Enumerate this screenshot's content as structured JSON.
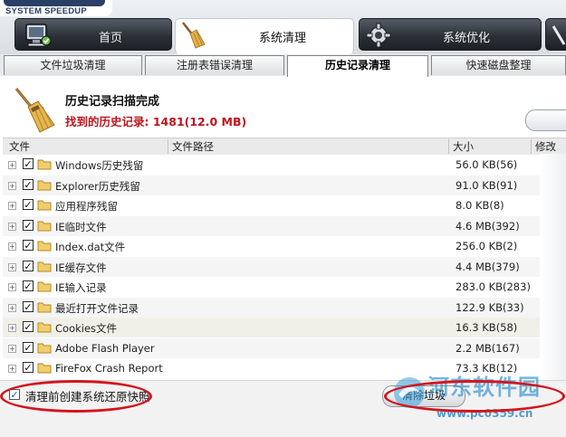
{
  "app": {
    "logo_text": "SYSTEM SPEEDUP"
  },
  "main_tabs": [
    {
      "label": "首页",
      "icon": "home-pc-icon"
    },
    {
      "label": "系统清理",
      "icon": "broom-icon"
    },
    {
      "label": "系统优化",
      "icon": "gear-icon"
    }
  ],
  "sub_tabs": [
    {
      "label": "文件垃圾清理"
    },
    {
      "label": "注册表错误清理"
    },
    {
      "label": "历史记录清理"
    },
    {
      "label": "快速磁盘整理"
    }
  ],
  "summary": {
    "title": "历史记录扫描完成",
    "found_label": "找到的历史记录:",
    "found_value": "1481(12.0 MB)"
  },
  "table": {
    "headers": [
      "文件",
      "文件路径",
      "大小",
      "修改时间"
    ],
    "rows": [
      {
        "name": "Windows历史残留",
        "size": "56.0 KB(56)",
        "checked": true
      },
      {
        "name": "Explorer历史残留",
        "size": "91.0 KB(91)",
        "checked": true
      },
      {
        "name": "应用程序残留",
        "size": "8.0 KB(8)",
        "checked": true
      },
      {
        "name": "IE临时文件",
        "size": "4.6 MB(392)",
        "checked": true
      },
      {
        "name": "Index.dat文件",
        "size": "256.0 KB(2)",
        "checked": true
      },
      {
        "name": "IE缓存文件",
        "size": "4.4 MB(379)",
        "checked": true
      },
      {
        "name": "IE输入记录",
        "size": "283.0 KB(283)",
        "checked": true
      },
      {
        "name": "最近打开文件记录",
        "size": "122.9 KB(33)",
        "checked": true
      },
      {
        "name": "Cookies文件",
        "size": "16.3 KB(58)",
        "checked": true
      },
      {
        "name": "Adobe Flash Player",
        "size": "2.2 MB(167)",
        "checked": true
      },
      {
        "name": "FireFox Crash Report",
        "size": "73.3 KB(12)",
        "checked": true
      }
    ]
  },
  "footer": {
    "restore_label": "清理前创建系统还原快照",
    "restore_checked": true,
    "clean_button": "清除垃圾"
  },
  "watermark": {
    "title": "河东软件园",
    "url": "www.pc0359.cn"
  },
  "colors": {
    "accent_red": "#c0141c",
    "annotation_red": "#d4141c",
    "watermark_blue": "#2a8fd0"
  }
}
